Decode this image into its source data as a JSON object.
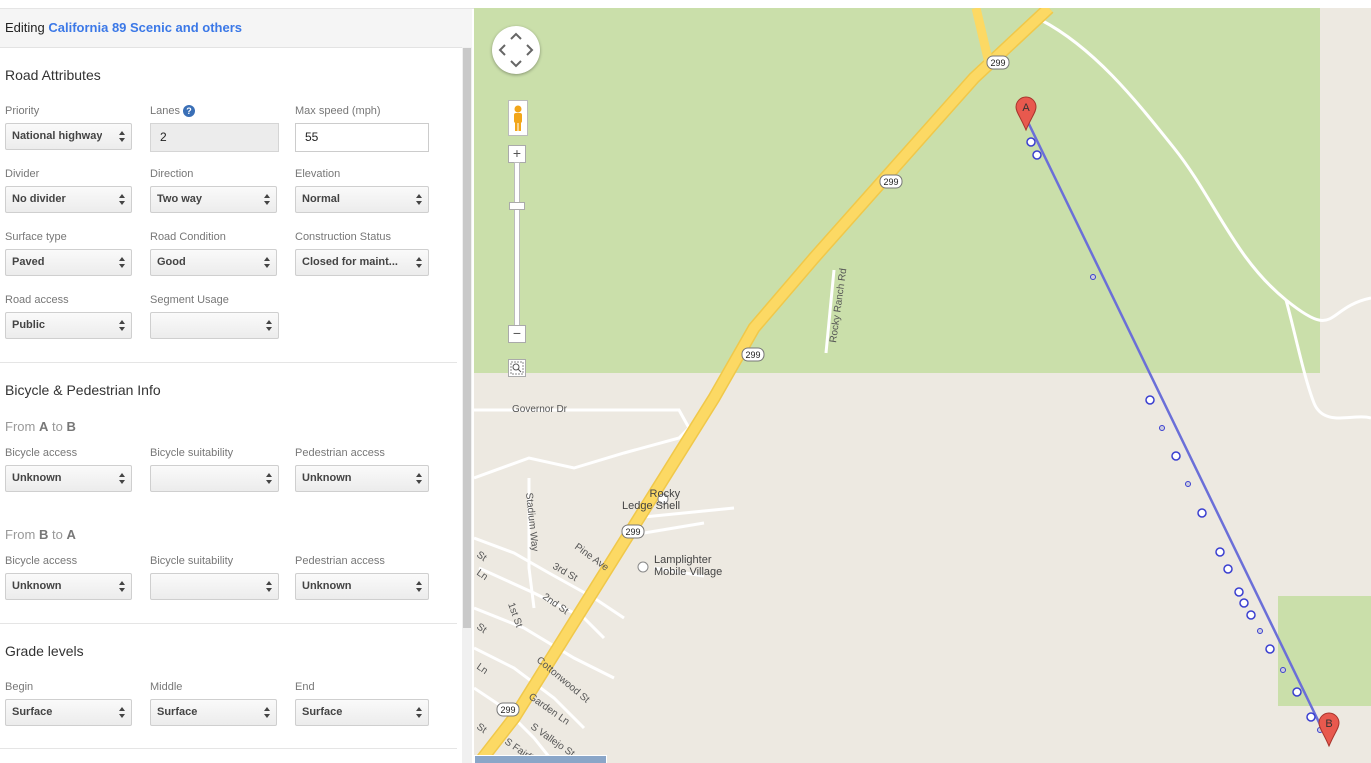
{
  "header": {
    "prefix": "Editing",
    "road_name": "California 89 Scenic and others"
  },
  "road_attributes": {
    "title": "Road Attributes",
    "priority": {
      "label": "Priority",
      "value": "National highway"
    },
    "lanes": {
      "label": "Lanes",
      "value": "2"
    },
    "max_speed": {
      "label": "Max speed (mph)",
      "value": "55"
    },
    "divider": {
      "label": "Divider",
      "value": "No divider"
    },
    "direction": {
      "label": "Direction",
      "value": "Two way"
    },
    "elevation": {
      "label": "Elevation",
      "value": "Normal"
    },
    "surface_type": {
      "label": "Surface type",
      "value": "Paved"
    },
    "road_condition": {
      "label": "Road Condition",
      "value": "Good"
    },
    "construction_status": {
      "label": "Construction Status",
      "value": "Closed for maint..."
    },
    "road_access": {
      "label": "Road access",
      "value": "Public"
    },
    "segment_usage": {
      "label": "Segment Usage",
      "value": ""
    }
  },
  "bike_ped": {
    "title": "Bicycle & Pedestrian Info",
    "a_to_b": {
      "from": "From",
      "a": "A",
      "to": "to",
      "b": "B",
      "bicycle_access": {
        "label": "Bicycle access",
        "value": "Unknown"
      },
      "bicycle_suitability": {
        "label": "Bicycle suitability",
        "value": ""
      },
      "pedestrian_access": {
        "label": "Pedestrian access",
        "value": "Unknown"
      }
    },
    "b_to_a": {
      "from": "From",
      "b": "B",
      "to": "to",
      "a": "A",
      "bicycle_access": {
        "label": "Bicycle access",
        "value": "Unknown"
      },
      "bicycle_suitability": {
        "label": "Bicycle suitability",
        "value": ""
      },
      "pedestrian_access": {
        "label": "Pedestrian access",
        "value": "Unknown"
      }
    }
  },
  "grade_levels": {
    "title": "Grade levels",
    "begin": {
      "label": "Begin",
      "value": "Surface"
    },
    "middle": {
      "label": "Middle",
      "value": "Surface"
    },
    "end": {
      "label": "End",
      "value": "Surface"
    }
  },
  "map": {
    "highway_shield": "299",
    "roads": {
      "rocky_ranch": "Rocky Ranch Rd",
      "governor": "Governor Dr",
      "stadium": "Stadium Way",
      "pine": "Pine Ave",
      "third": "3rd St",
      "second": "2nd St",
      "first": "1st St",
      "cottonwood": "Cottonwood St",
      "garden": "Garden Ln",
      "vallejo": "S Vallejo St",
      "fairfield": "S Fairfi...",
      "st1": "St",
      "ln1": "Ln",
      "st2": "St",
      "ln2": "Ln",
      "st3": "St"
    },
    "poi_rocky_ledge": [
      "Rocky",
      "Ledge Shell"
    ],
    "poi_lamplighter": [
      "Lamplighter",
      "Mobile Village"
    ],
    "marker_a": "A",
    "marker_b": "B",
    "colors": {
      "forest": "#cadfaa",
      "land": "#ede9e1",
      "highway": "#fcd964",
      "route": "#6b6fd8",
      "marker": "#e74c3c"
    }
  }
}
